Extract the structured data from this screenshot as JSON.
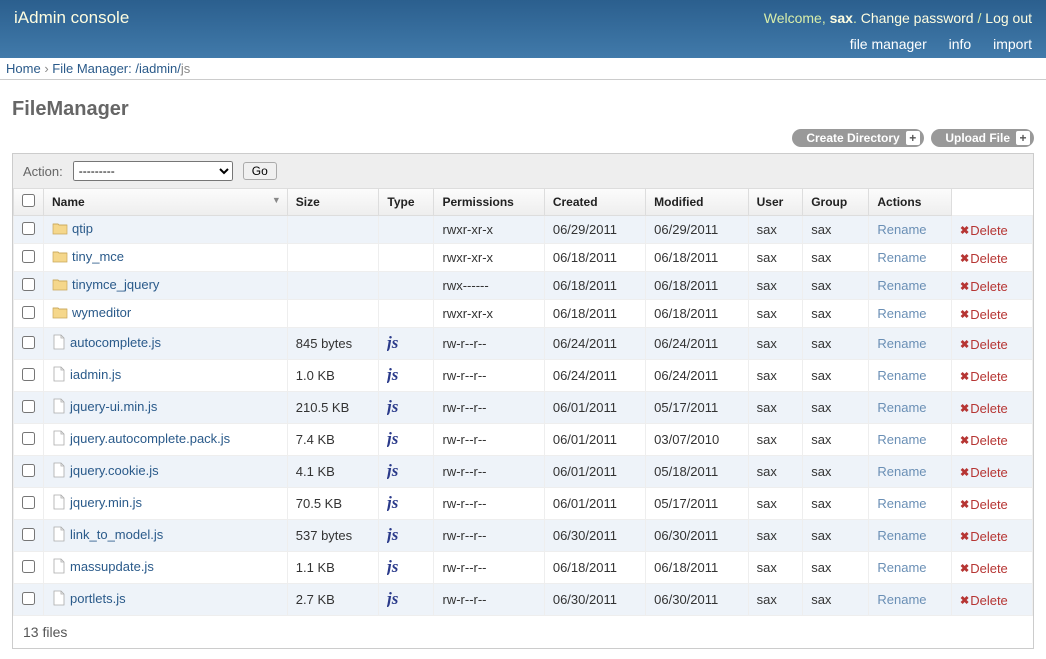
{
  "header": {
    "app_title": "iAdmin console",
    "welcome": "Welcome, ",
    "username": "sax",
    "period": ". ",
    "change_password": "Change password",
    "sep": " / ",
    "logout": "Log out",
    "nav": {
      "file_manager": "file manager",
      "info": "info",
      "import": "import"
    }
  },
  "breadcrumb": {
    "home": "Home",
    "fm_label": "File Manager: ",
    "path_link": "/iadmin/",
    "path_current": "js"
  },
  "page": {
    "title": "FileManager",
    "btn_create_dir": "Create Directory",
    "btn_upload": "Upload File"
  },
  "action_bar": {
    "label": "Action:",
    "placeholder": "---------",
    "go": "Go"
  },
  "columns": {
    "name": "Name",
    "size": "Size",
    "type": "Type",
    "permissions": "Permissions",
    "created": "Created",
    "modified": "Modified",
    "user": "User",
    "group": "Group",
    "actions": "Actions"
  },
  "action_labels": {
    "rename": "Rename",
    "delete": "Delete"
  },
  "rows": [
    {
      "icon": "folder",
      "name": "qtip",
      "size": "",
      "type": "",
      "perm": "rwxr-xr-x",
      "created": "06/29/2011",
      "modified": "06/29/2011",
      "user": "sax",
      "group": "sax"
    },
    {
      "icon": "folder",
      "name": "tiny_mce",
      "size": "",
      "type": "",
      "perm": "rwxr-xr-x",
      "created": "06/18/2011",
      "modified": "06/18/2011",
      "user": "sax",
      "group": "sax"
    },
    {
      "icon": "folder",
      "name": "tinymce_jquery",
      "size": "",
      "type": "",
      "perm": "rwx------",
      "created": "06/18/2011",
      "modified": "06/18/2011",
      "user": "sax",
      "group": "sax"
    },
    {
      "icon": "folder",
      "name": "wymeditor",
      "size": "",
      "type": "",
      "perm": "rwxr-xr-x",
      "created": "06/18/2011",
      "modified": "06/18/2011",
      "user": "sax",
      "group": "sax"
    },
    {
      "icon": "file",
      "name": "autocomplete.js",
      "size": "845 bytes",
      "type": "js",
      "perm": "rw-r--r--",
      "created": "06/24/2011",
      "modified": "06/24/2011",
      "user": "sax",
      "group": "sax"
    },
    {
      "icon": "file",
      "name": "iadmin.js",
      "size": "1.0 KB",
      "type": "js",
      "perm": "rw-r--r--",
      "created": "06/24/2011",
      "modified": "06/24/2011",
      "user": "sax",
      "group": "sax"
    },
    {
      "icon": "file",
      "name": "jquery-ui.min.js",
      "size": "210.5 KB",
      "type": "js",
      "perm": "rw-r--r--",
      "created": "06/01/2011",
      "modified": "05/17/2011",
      "user": "sax",
      "group": "sax"
    },
    {
      "icon": "file",
      "name": "jquery.autocomplete.pack.js",
      "size": "7.4 KB",
      "type": "js",
      "perm": "rw-r--r--",
      "created": "06/01/2011",
      "modified": "03/07/2010",
      "user": "sax",
      "group": "sax"
    },
    {
      "icon": "file",
      "name": "jquery.cookie.js",
      "size": "4.1 KB",
      "type": "js",
      "perm": "rw-r--r--",
      "created": "06/01/2011",
      "modified": "05/18/2011",
      "user": "sax",
      "group": "sax"
    },
    {
      "icon": "file",
      "name": "jquery.min.js",
      "size": "70.5 KB",
      "type": "js",
      "perm": "rw-r--r--",
      "created": "06/01/2011",
      "modified": "05/17/2011",
      "user": "sax",
      "group": "sax"
    },
    {
      "icon": "file",
      "name": "link_to_model.js",
      "size": "537 bytes",
      "type": "js",
      "perm": "rw-r--r--",
      "created": "06/30/2011",
      "modified": "06/30/2011",
      "user": "sax",
      "group": "sax"
    },
    {
      "icon": "file",
      "name": "massupdate.js",
      "size": "1.1 KB",
      "type": "js",
      "perm": "rw-r--r--",
      "created": "06/18/2011",
      "modified": "06/18/2011",
      "user": "sax",
      "group": "sax"
    },
    {
      "icon": "file",
      "name": "portlets.js",
      "size": "2.7 KB",
      "type": "js",
      "perm": "rw-r--r--",
      "created": "06/30/2011",
      "modified": "06/30/2011",
      "user": "sax",
      "group": "sax"
    }
  ],
  "footer": {
    "count": "13 files"
  }
}
